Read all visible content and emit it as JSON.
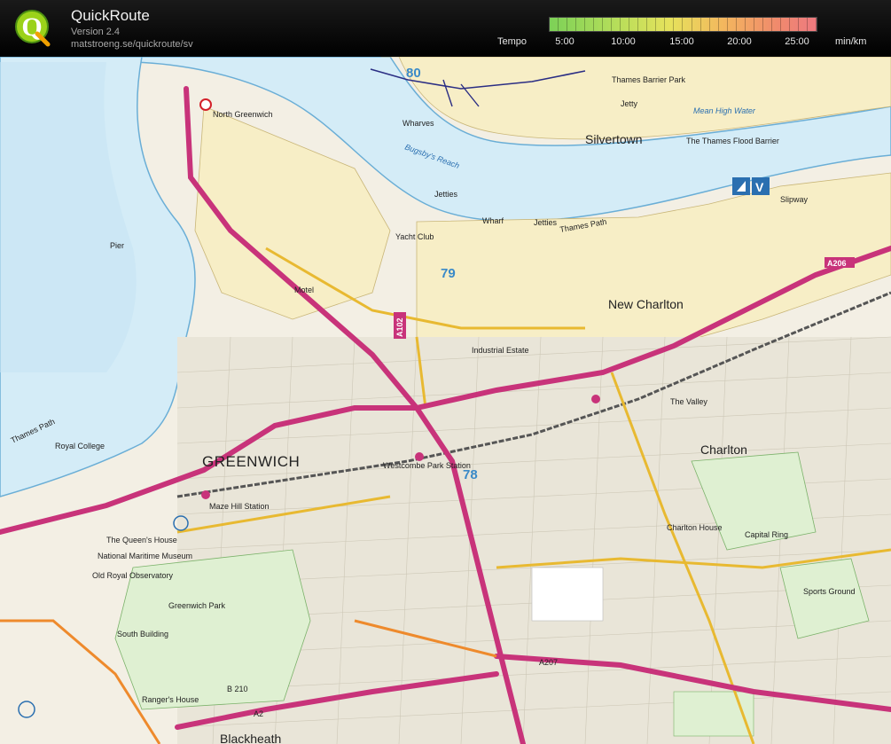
{
  "app": {
    "title": "QuickRoute",
    "version": "Version 2.4",
    "url": "matstroeng.se/quickroute/sv"
  },
  "legend": {
    "label": "Tempo",
    "ticks": [
      "5:00",
      "10:00",
      "15:00",
      "20:00",
      "25:00"
    ],
    "unit": "min/km",
    "colors": [
      "#7cd157",
      "#b6de5a",
      "#e6e25c",
      "#f3b75e",
      "#f08a6c",
      "#ee7a80"
    ]
  },
  "map": {
    "places": {
      "greenwich": "GREENWICH",
      "charlton": "Charlton",
      "new_charlton": "New Charlton",
      "silvertown": "Silvertown",
      "blackheath": "Blackheath",
      "greenwich_park": "Greenwich Park",
      "thames_flood_barrier": "The Thames Flood Barrier",
      "thames_barrier_park": "Thames Barrier Park",
      "industrial_estate": "Industrial Estate",
      "the_valley": "The Valley",
      "maze_hill_station": "Maze Hill Station",
      "westcombe_park_station": "Westcombe Park Station",
      "north_greenwich": "North Greenwich",
      "queens_house": "The Queen's House",
      "national_maritime_museum": "National Maritime Museum",
      "old_royal_observatory": "Old Royal Observatory",
      "charlton_house": "Charlton House",
      "rangers_house": "Ranger's House",
      "sports_ground": "Sports Ground",
      "capital_ring": "Capital Ring",
      "yacht_club": "Yacht Club",
      "royal_college": "Royal College",
      "motel": "Motel",
      "south_building": "South Building"
    },
    "water": {
      "bugsbys_reach": "Bugsby's Reach",
      "mean_high_water": "Mean High Water",
      "thames_path": "Thames Path",
      "jetties": "Jetties",
      "wharves": "Wharves",
      "wharf": "Wharf",
      "jetty": "Jetty",
      "slipway": "Slipway",
      "pier": "Pier"
    },
    "roads": {
      "a102": "A102",
      "a206": "A206",
      "a2": "A2",
      "a207": "A207",
      "b210": "B 210"
    },
    "grid": [
      "80",
      "79",
      "78"
    ]
  }
}
